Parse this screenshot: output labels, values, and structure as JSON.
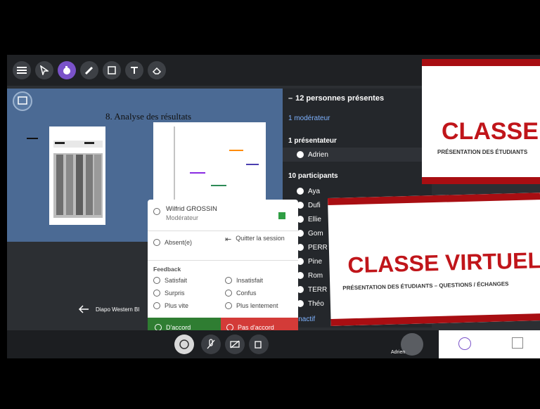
{
  "slide": {
    "title": "8. Analyse des résultats",
    "nav_label": "Diapo Western Bl"
  },
  "participants": {
    "header": "12 personnes présentes",
    "moderators": "1 modérateur",
    "presenters": "1 présentateur",
    "presenter_name": "Adrien",
    "participants_label": "10 participants",
    "names": [
      "Aya",
      "Dufi",
      "Ellie",
      "Gom",
      "PERR",
      "Pine",
      "Rom",
      "TERR",
      "Théo"
    ],
    "footer": "inactif"
  },
  "menu": {
    "user_name": "Wilfrid GROSSIN",
    "user_role": "Modérateur",
    "absent": "Absent(e)",
    "leave": "Quitter la session",
    "feedback_title": "Feedback",
    "items": [
      "Satisfait",
      "Insatisfait",
      "Surpris",
      "Confus",
      "Plus vite",
      "Plus lentement"
    ],
    "agree": "D'accord",
    "disagree": "Pas d'accord"
  },
  "promo": {
    "title_top": "CLASSE VI",
    "subtitle_top": "PRÉSENTATION DES ÉTUDIANTS",
    "title_bottom": "CLASSE VIRTUELLE-",
    "subtitle_bottom": "PRÉSENTATION DES ÉTUDIANTS – QUESTIONS / ÉCHANGES"
  },
  "bottom": {
    "avatar_label": "Adrien"
  },
  "colors": {
    "accent": "#7a52c9",
    "agree": "#2f7d32",
    "disagree": "#d33b38",
    "promo_red": "#c0151a"
  }
}
